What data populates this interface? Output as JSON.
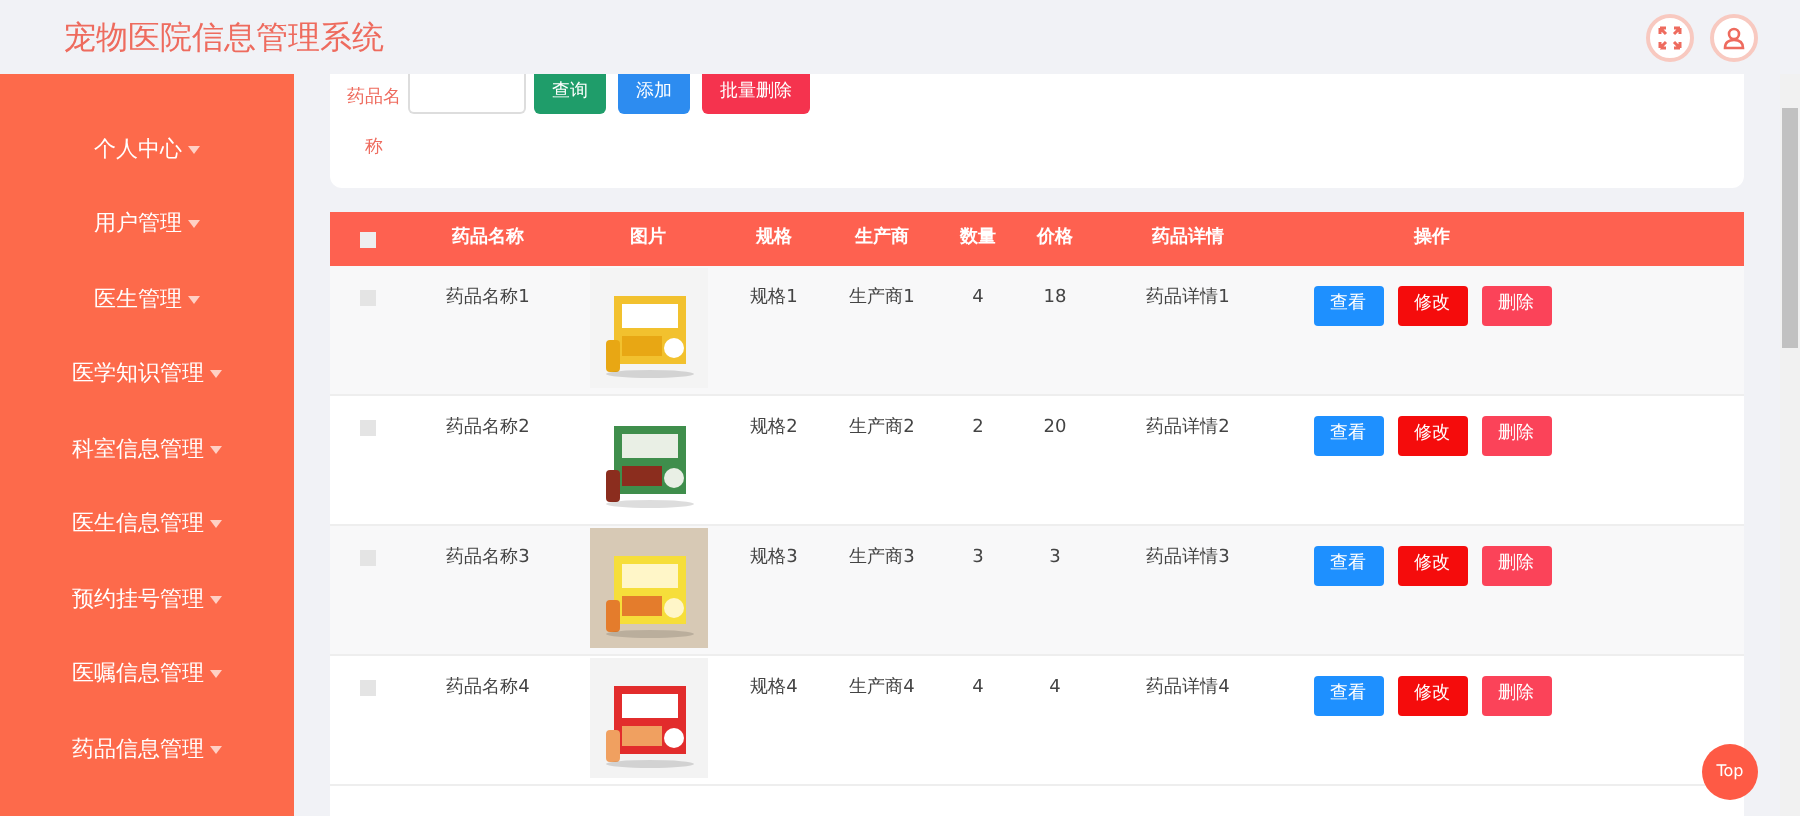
{
  "header": {
    "title": "宠物医院信息管理系统"
  },
  "sidebar": {
    "items": [
      {
        "label": "个人中心"
      },
      {
        "label": "用户管理"
      },
      {
        "label": "医生管理"
      },
      {
        "label": "医学知识管理"
      },
      {
        "label": "科室信息管理"
      },
      {
        "label": "医生信息管理"
      },
      {
        "label": "预约挂号管理"
      },
      {
        "label": "医嘱信息管理"
      },
      {
        "label": "药品信息管理"
      }
    ]
  },
  "search": {
    "label": "药品名称",
    "buttons": [
      {
        "label": "查询",
        "kind": "query"
      },
      {
        "label": "添加",
        "kind": "add"
      },
      {
        "label": "批量删除",
        "kind": "bulk-delete"
      }
    ]
  },
  "table": {
    "all_checked": false,
    "columns": [
      "药品名称",
      "图片",
      "规格",
      "生产商",
      "数量",
      "价格",
      "药品详情",
      "操作"
    ],
    "rows": [
      {
        "name": "药品名称1",
        "image": {
          "kind": "picture"
        },
        "spec": "规格1",
        "maker": "生产商1",
        "quantity": "4",
        "price": "18",
        "detail": "药品详情1",
        "checked": false,
        "actions": [
          "查看",
          "修改",
          "删除"
        ]
      },
      {
        "name": "药品名称2",
        "image": {
          "kind": "picture"
        },
        "spec": "规格2",
        "maker": "生产商2",
        "quantity": "2",
        "price": "20",
        "detail": "药品详情2",
        "checked": false,
        "actions": [
          "查看",
          "修改",
          "删除"
        ]
      },
      {
        "name": "药品名称3",
        "image": {
          "kind": "picture"
        },
        "spec": "规格3",
        "maker": "生产商3",
        "quantity": "3",
        "price": "3",
        "detail": "药品详情3",
        "checked": false,
        "actions": [
          "查看",
          "修改",
          "删除"
        ]
      },
      {
        "name": "药品名称4",
        "image": {
          "kind": "picture"
        },
        "spec": "规格4",
        "maker": "生产商4",
        "quantity": "4",
        "price": "4",
        "detail": "药品详情4",
        "checked": false,
        "actions": [
          "查看",
          "修改",
          "删除"
        ]
      }
    ]
  },
  "top_button": {
    "label": "Top"
  }
}
